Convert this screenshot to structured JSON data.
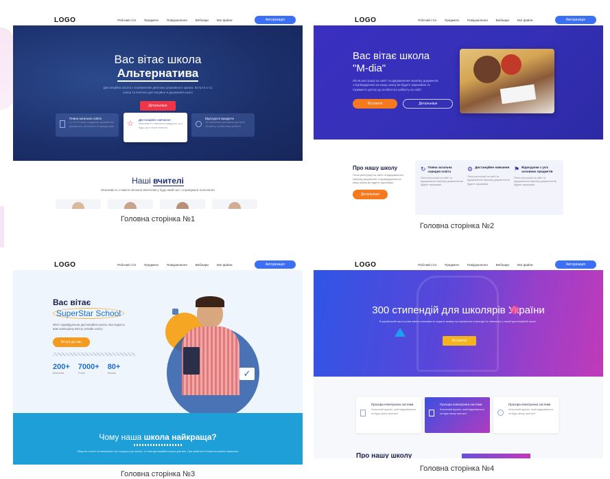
{
  "nav": {
    "logo": "LOGO",
    "links": [
      "Робочий стіл",
      "Предмети",
      "Повідомлення",
      "Вебінари",
      "Мої файли"
    ],
    "auth_button": "Авторизація"
  },
  "cards": [
    {
      "caption": "Головна сторінка №1",
      "hero_title_line1": "Вас вітає школа",
      "hero_title_line2": "Альтернатива",
      "hero_text": "Дистанційна школа з отриманням диплому державного зразка. Вступ в 1-11 класи та вчитися дистанційно в державній школі",
      "hero_button": "Детальніше",
      "features": [
        {
          "title": "Повна загальна освіта",
          "text": "з 1 по 11 клас з видачею державного документу, засновник та акредитація"
        },
        {
          "title": "Дистанційне навчання",
          "text": "Можливість навчатися звідусіль та з будь-якої точки планети"
        },
        {
          "title": "Відсоурсні продукти",
          "text": "Усі навчальні матеріали доступні онлайн у особистому кабінеті"
        }
      ],
      "teachers_title_plain": "Наші",
      "teachers_title_bold": "вчителі",
      "teachers_text": "Можливість ставити питання вчителям у будь-який час і отримувати пояснення"
    },
    {
      "caption": "Головна сторінка №2",
      "hero_title_line1": "Вас вітає школа",
      "hero_title_line2": "\"M-dia\"",
      "hero_text": "Після реєстрації на сайті та відправлення переліку документів з підтвердження на нашу школу ви будете зараховані та отримаєте доступ до особистого кабінету на сайті",
      "hero_button_primary": "Вступити",
      "hero_button_secondary": "Детальніше",
      "about_title": "Про нашу школу",
      "about_text": "Після реєстрації на сайті та відправлення переліку документів з підтвердження на нашу школу ви будете зараховані",
      "about_button": "Детальніше",
      "features": [
        {
          "title": "Повна загальна середня освіта",
          "text": "Після реєстрації на сайті та відправлення переліку документів ви будете зараховані"
        },
        {
          "title": "Дистанційне навчання",
          "text": "Після реєстрації на сайті та відправлення переліку документів ви будете зараховані"
        },
        {
          "title": "Відеоуроки з усіх основних предметів",
          "text": "Після реєстрації на сайті та відправлення переліку документів ви будете зараховані"
        }
      ]
    },
    {
      "caption": "Головна сторінка №3",
      "hero_title_line1": "Вас вітає",
      "hero_title_line2": "SuperStar School",
      "hero_text": "Місії: Індивідуальна дистанційна школа, яка надасть вам повноцінну якісну онлайн освіту",
      "hero_button": "Вступ до нас",
      "stats": [
        {
          "value": "200+",
          "label": "Вчителів"
        },
        {
          "value": "7000+",
          "label": "Учнів"
        },
        {
          "value": "80+",
          "label": "Класів"
        }
      ],
      "why_title_plain": "Чому наша",
      "why_title_bold": "школа найкраща?",
      "why_text": "Якщо ви хочете не витрачати час на дорогу до школи, то така дистанційна школа для вас. При наявності інтернету можна навчатися"
    },
    {
      "caption": "Головна сторінка №4",
      "hero_title": "300 стипендій для школярів України",
      "hero_text": "В українській школі учнів мають можливість подати заявку на отримання стипендії на навчання у нашій дистанційній школі",
      "hero_button": "Вступити",
      "features": [
        {
          "title": "Прозора електронна система",
          "text": "Класичний журнал, який відкривається на будь-якому пристрої"
        },
        {
          "title": "Прозора електронна система",
          "text": "Класичний журнал, який відкривається на будь-якому пристрої"
        },
        {
          "title": "Прозора електронна система",
          "text": "Класичний журнал, який відкривається на будь-якому пристрої"
        }
      ],
      "about_title": "Про нашу школу"
    }
  ],
  "colors": {
    "accent_blue": "#3b6ff5",
    "hero1_bg": "#1c2f6b",
    "hero2_bg": "#3530b8",
    "hero4_from": "#2f55e6",
    "hero4_to": "#c03ab8",
    "red_button": "#f0354a",
    "orange_button": "#f59a1e",
    "cyan_band": "#1e9fd8"
  }
}
